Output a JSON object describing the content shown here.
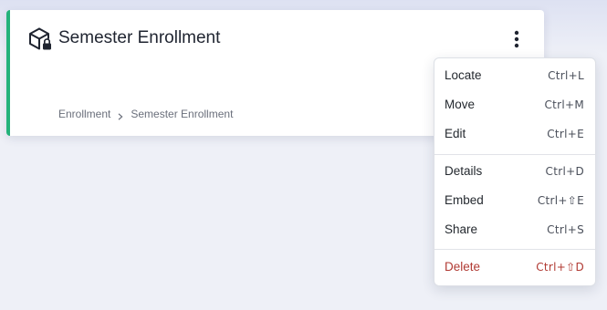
{
  "card": {
    "title": "Semester Enrollment",
    "breadcrumb": [
      "Enrollment",
      "Semester Enrollment"
    ],
    "accent_color": "#23b27a",
    "icon": "locked-package-icon"
  },
  "menu": {
    "items": [
      {
        "label": "Locate",
        "shortcut": "Ctrl+L"
      },
      {
        "label": "Move",
        "shortcut": "Ctrl+M"
      },
      {
        "label": "Edit",
        "shortcut": "Ctrl+E"
      },
      {
        "label": "Details",
        "shortcut": "Ctrl+D"
      },
      {
        "label": "Embed",
        "shortcut": "Ctrl+⇧E"
      },
      {
        "label": "Share",
        "shortcut": "Ctrl+S"
      },
      {
        "label": "Delete",
        "shortcut": "Ctrl+⇧D"
      }
    ],
    "danger_color": "#b13a33"
  }
}
